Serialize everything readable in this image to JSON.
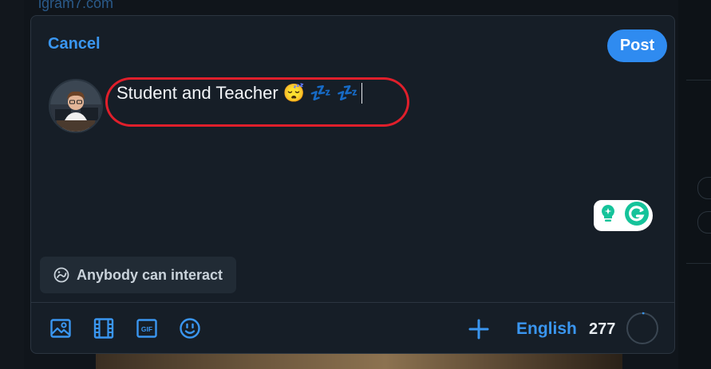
{
  "background": {
    "link_text": "lgram7.com"
  },
  "composer": {
    "cancel_label": "Cancel",
    "post_label": "Post",
    "post_text": "Student and Teacher 😴 💤 💤",
    "audience_label": "Anybody can interact",
    "language_label": "English",
    "char_count": "277",
    "char_progress": 0.02,
    "accent_color": "#3a96f0"
  },
  "icons": {
    "audience": "globe-interaction-icon",
    "image": "image-icon",
    "video": "video-icon",
    "gif": "gif-icon",
    "emoji": "emoji-icon",
    "add": "plus-icon",
    "grammarly": "grammarly-icon",
    "grammar_hint": "lightbulb-icon"
  },
  "gif_label": "GIF"
}
